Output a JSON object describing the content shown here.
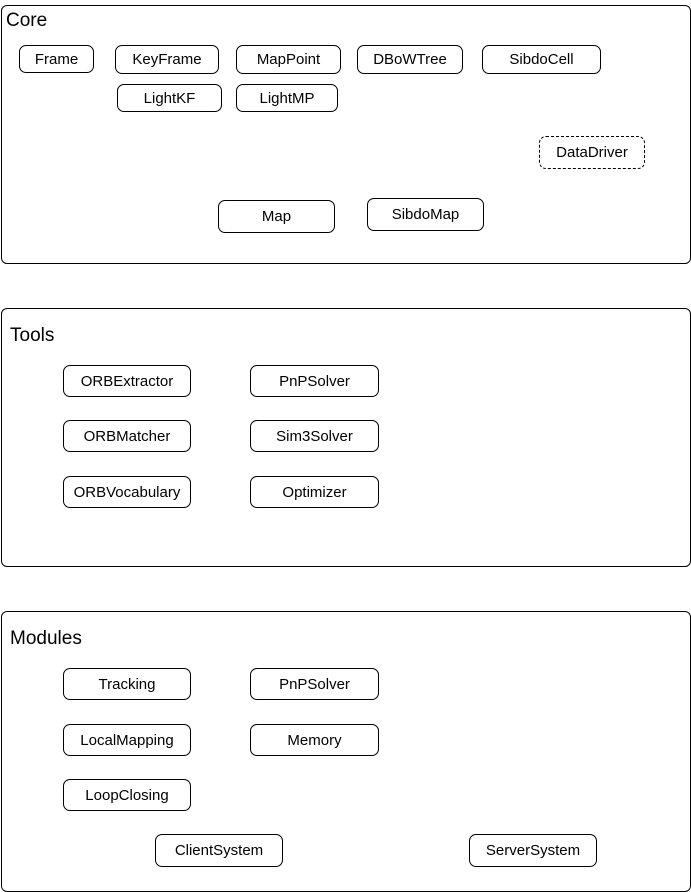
{
  "core": {
    "title": "Core",
    "nodes": {
      "frame": "Frame",
      "keyframe": "KeyFrame",
      "mappoint": "MapPoint",
      "dbowtree": "DBoWTree",
      "sibdocell": "SibdoCell",
      "lightkf": "LightKF",
      "lightmp": "LightMP",
      "datadriver": "DataDriver",
      "map": "Map",
      "sibdomap": "SibdoMap"
    }
  },
  "tools": {
    "title": "Tools",
    "nodes": {
      "orbextractor": "ORBExtractor",
      "pnpsolver": "PnPSolver",
      "orbmatcher": "ORBMatcher",
      "sim3solver": "Sim3Solver",
      "orbvocabulary": "ORBVocabulary",
      "optimizer": "Optimizer"
    }
  },
  "modules": {
    "title": "Modules",
    "nodes": {
      "tracking": "Tracking",
      "pnpsolver": "PnPSolver",
      "localmapping": "LocalMapping",
      "memory": "Memory",
      "loopclosing": "LoopClosing",
      "clientsystem": "ClientSystem",
      "serversystem": "ServerSystem"
    }
  }
}
